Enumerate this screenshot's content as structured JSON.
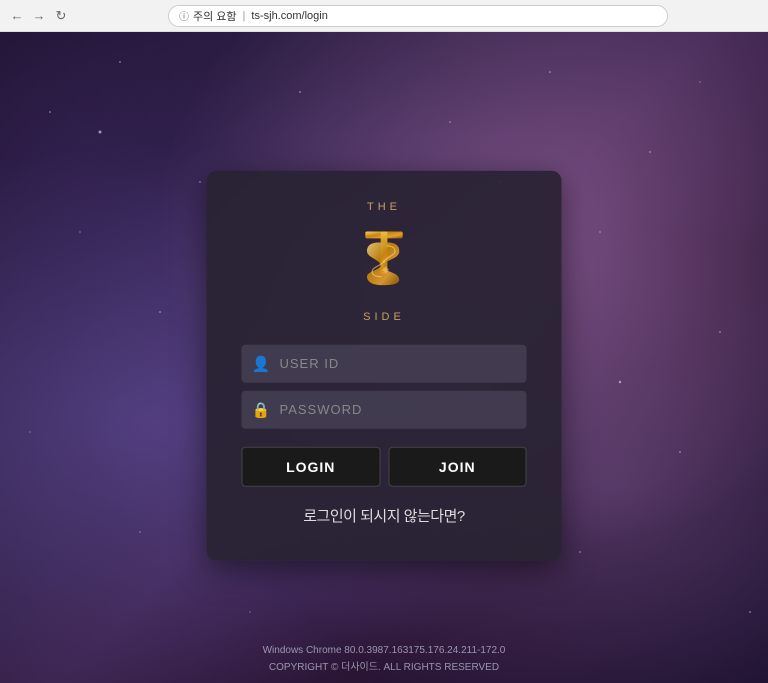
{
  "browser": {
    "url": "ts-sjh.com/login",
    "security_label": "주의 요함",
    "reload_icon": "↻"
  },
  "logo": {
    "the_text": "THE",
    "side_text": "SIDE"
  },
  "form": {
    "userid_placeholder": "USER ID",
    "password_placeholder": "PASSWORD",
    "login_label": "LOGIN",
    "join_label": "JOIN",
    "forgot_text": "로그인이 되시지 않는다면?"
  },
  "footer": {
    "line1": "Windows Chrome 80.0.3987.163175.176.24.211-172.0",
    "line2": "COPYRIGHT © 더사이드. ALL RIGHTS RESERVED"
  }
}
